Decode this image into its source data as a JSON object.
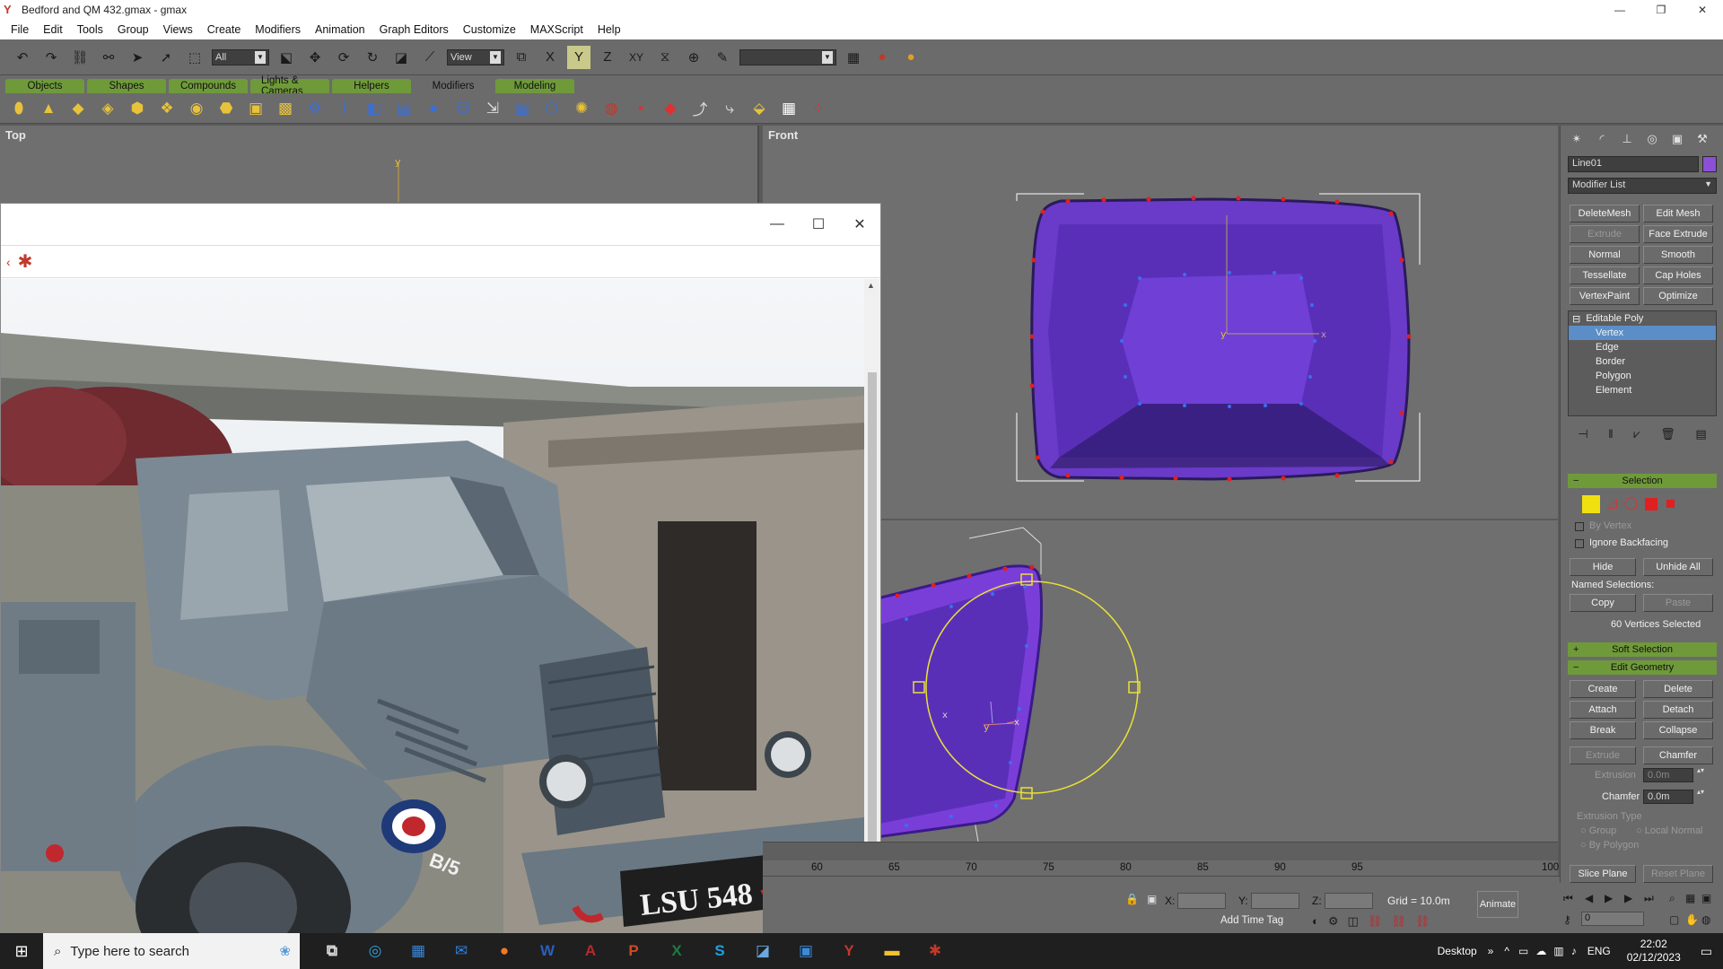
{
  "window": {
    "title": "Bedford and QM 432.gmax - gmax",
    "min": "—",
    "max": "❐",
    "close": "✕"
  },
  "menu": [
    "File",
    "Edit",
    "Tools",
    "Group",
    "Views",
    "Create",
    "Modifiers",
    "Animation",
    "Graph Editors",
    "Customize",
    "MAXScript",
    "Help"
  ],
  "toolbar": {
    "selection_filter": "All",
    "ref_coord": "View",
    "axis_labels": [
      "X",
      "Y",
      "Z",
      "XY"
    ],
    "named_selection": ""
  },
  "tabs": [
    "Objects",
    "Shapes",
    "Compounds",
    "Lights & Cameras",
    "Helpers",
    "Modifiers",
    "Modeling"
  ],
  "active_tab": "Modifiers",
  "viewports": {
    "top_label": "Top",
    "front_label": "Front"
  },
  "image_window": {
    "min": "—",
    "max": "☐",
    "close": "✕",
    "photo": {
      "plate": "LSU 548",
      "door_marking": "B/5"
    }
  },
  "command_panel": {
    "object_name": "Line01",
    "object_color": "#8c4fd8",
    "modifier_list": "Modifier List",
    "modifier_buttons": [
      {
        "label": "DeleteMesh",
        "enabled": true
      },
      {
        "label": "Edit Mesh",
        "enabled": true
      },
      {
        "label": "Extrude",
        "enabled": false
      },
      {
        "label": "Face Extrude",
        "enabled": true
      },
      {
        "label": "Normal",
        "enabled": true
      },
      {
        "label": "Smooth",
        "enabled": true
      },
      {
        "label": "Tessellate",
        "enabled": true
      },
      {
        "label": "Cap Holes",
        "enabled": true
      },
      {
        "label": "VertexPaint",
        "enabled": true
      },
      {
        "label": "Optimize",
        "enabled": true
      }
    ],
    "stack": {
      "root": "Editable Poly",
      "items": [
        "Vertex",
        "Edge",
        "Border",
        "Polygon",
        "Element"
      ],
      "selected": "Vertex"
    },
    "selection": {
      "title": "Selection",
      "by_vertex": "By Vertex",
      "ignore_backfacing": "Ignore Backfacing",
      "hide": "Hide",
      "unhide_all": "Unhide All",
      "named_selections": "Named Selections:",
      "copy": "Copy",
      "paste": "Paste",
      "status": "60 Vertices Selected"
    },
    "soft_selection": "Soft Selection",
    "edit_geometry": {
      "title": "Edit Geometry",
      "create": "Create",
      "delete": "Delete",
      "attach": "Attach",
      "detach": "Detach",
      "break": "Break",
      "collapse": "Collapse",
      "extrude": "Extrude",
      "chamfer": "Chamfer",
      "extrusion_label": "Extrusion",
      "extrusion_value": "0.0m",
      "chamfer_label": "Chamfer",
      "chamfer_value": "0.0m",
      "extrusion_type": "Extrusion Type",
      "group": "Group",
      "local_normal": "Local Normal",
      "by_polygon": "By Polygon",
      "slice_plane": "Slice Plane",
      "reset_plane": "Reset Plane"
    }
  },
  "timeline": {
    "ticks": [
      "60",
      "65",
      "70",
      "75",
      "80",
      "85",
      "90",
      "95",
      "100"
    ]
  },
  "status": {
    "x_label": "X:",
    "y_label": "Y:",
    "z_label": "Z:",
    "grid": "Grid = 10.0m",
    "animate": "Animate",
    "add_time_tag": "Add Time Tag",
    "frame": "0"
  },
  "taskbar": {
    "search_placeholder": "Type here to search",
    "desktop": "Desktop",
    "lang": "ENG",
    "time": "22:02",
    "date": "02/12/2023"
  }
}
